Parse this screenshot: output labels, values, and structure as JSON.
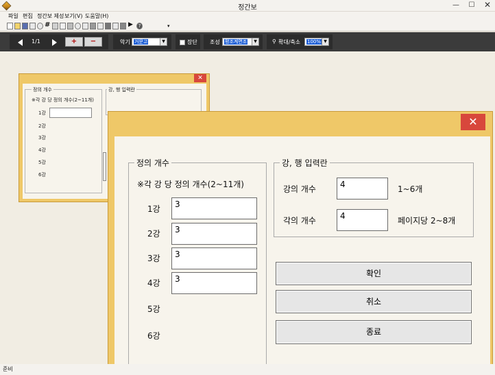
{
  "window": {
    "title": "정간보",
    "minimize": "—",
    "maximize": "☐",
    "close": "✕"
  },
  "menu": [
    "파일",
    "편집",
    "정간보 제성",
    "보기(V)",
    "도움말(H)"
  ],
  "navbar": {
    "page": "1/1",
    "add_button": "+",
    "remove_button": "−",
    "instrument_label": "악기",
    "instrument_value": "거문고",
    "jangdan_label": "장단",
    "key_label": "조성",
    "key_value": "평조계면조",
    "zoom_label": "확대/축소",
    "zoom_value": "100%"
  },
  "small_dialog": {
    "close": "✕",
    "group1_title": "정의 개수",
    "group2_title": "강, 행 입력란",
    "note": "※각 강 당 정의 개수(2~11개)",
    "rows": [
      "1강",
      "2강",
      "3강",
      "4강",
      "5강",
      "6강"
    ]
  },
  "main_dialog": {
    "close": "✕",
    "count_group": {
      "title": "정의 개수",
      "note": "※각 강 당 정의 개수(2~11개)",
      "rows": [
        {
          "label": "1강",
          "value": "3"
        },
        {
          "label": "2강",
          "value": "3"
        },
        {
          "label": "3강",
          "value": "3"
        },
        {
          "label": "4강",
          "value": "3"
        },
        {
          "label": "5강",
          "value": ""
        },
        {
          "label": "6강",
          "value": ""
        }
      ]
    },
    "input_group": {
      "title": "강, 행 입력란",
      "gang_label": "강의 개수",
      "gang_value": "4",
      "gang_range": "1~6개",
      "gak_label": "각의 개수",
      "gak_value": "4",
      "gak_range": "페이지당 2~8개"
    },
    "buttons": {
      "ok": "확인",
      "cancel": "취소",
      "exit": "종료"
    }
  },
  "status": "준비"
}
